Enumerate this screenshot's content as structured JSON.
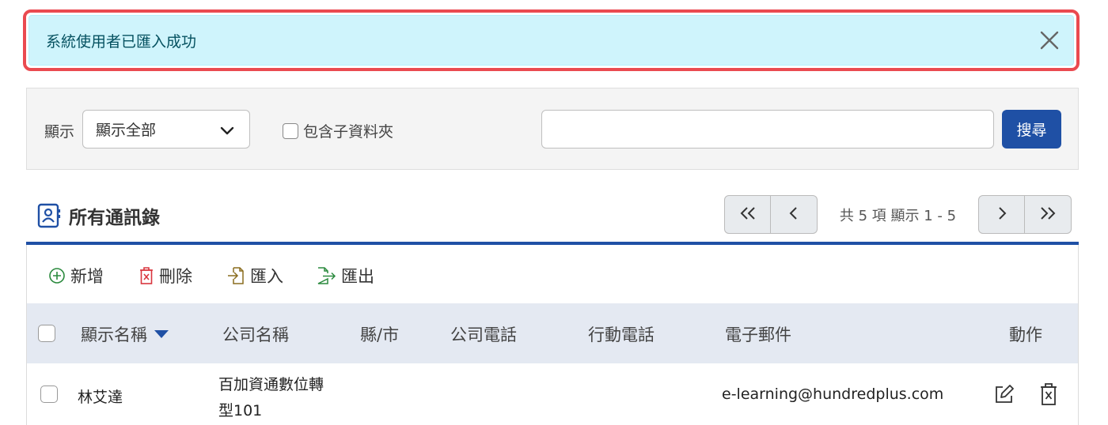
{
  "alert": {
    "message": "系統使用者已匯入成功"
  },
  "filter": {
    "label": "顯示",
    "select_value": "顯示全部",
    "include_subfolders_label": "包含子資料夾",
    "search_placeholder": "",
    "search_button": "搜尋"
  },
  "section": {
    "title": "所有通訊錄"
  },
  "pager": {
    "info": "共 5 項 顯示 1 - 5"
  },
  "toolbar": {
    "add": "新增",
    "delete": "刪除",
    "import": "匯入",
    "export": "匯出"
  },
  "table": {
    "columns": {
      "display_name": "顯示名稱",
      "company": "公司名稱",
      "county": "縣/市",
      "company_phone": "公司電話",
      "mobile": "行動電話",
      "email": "電子郵件",
      "action": "動作"
    },
    "rows": [
      {
        "display_name": "林艾達",
        "company_line1": "百加資通數位轉",
        "company_line2": "型101",
        "county": "",
        "company_phone": "",
        "mobile": "",
        "email": "e-learning@hundredplus.com"
      }
    ]
  },
  "icons": [
    "close-icon",
    "chevron-down-icon",
    "contact-book-icon",
    "double-left-icon",
    "left-icon",
    "right-icon",
    "double-right-icon",
    "plus-circle-icon",
    "trash-icon",
    "import-icon",
    "export-icon",
    "sort-desc-icon",
    "edit-icon",
    "delete-icon"
  ],
  "colors": {
    "alert_bg": "#cff4fc",
    "alert_outline": "#ea4a50",
    "primary": "#1f50a5",
    "header_bg": "#e4e9f2"
  }
}
